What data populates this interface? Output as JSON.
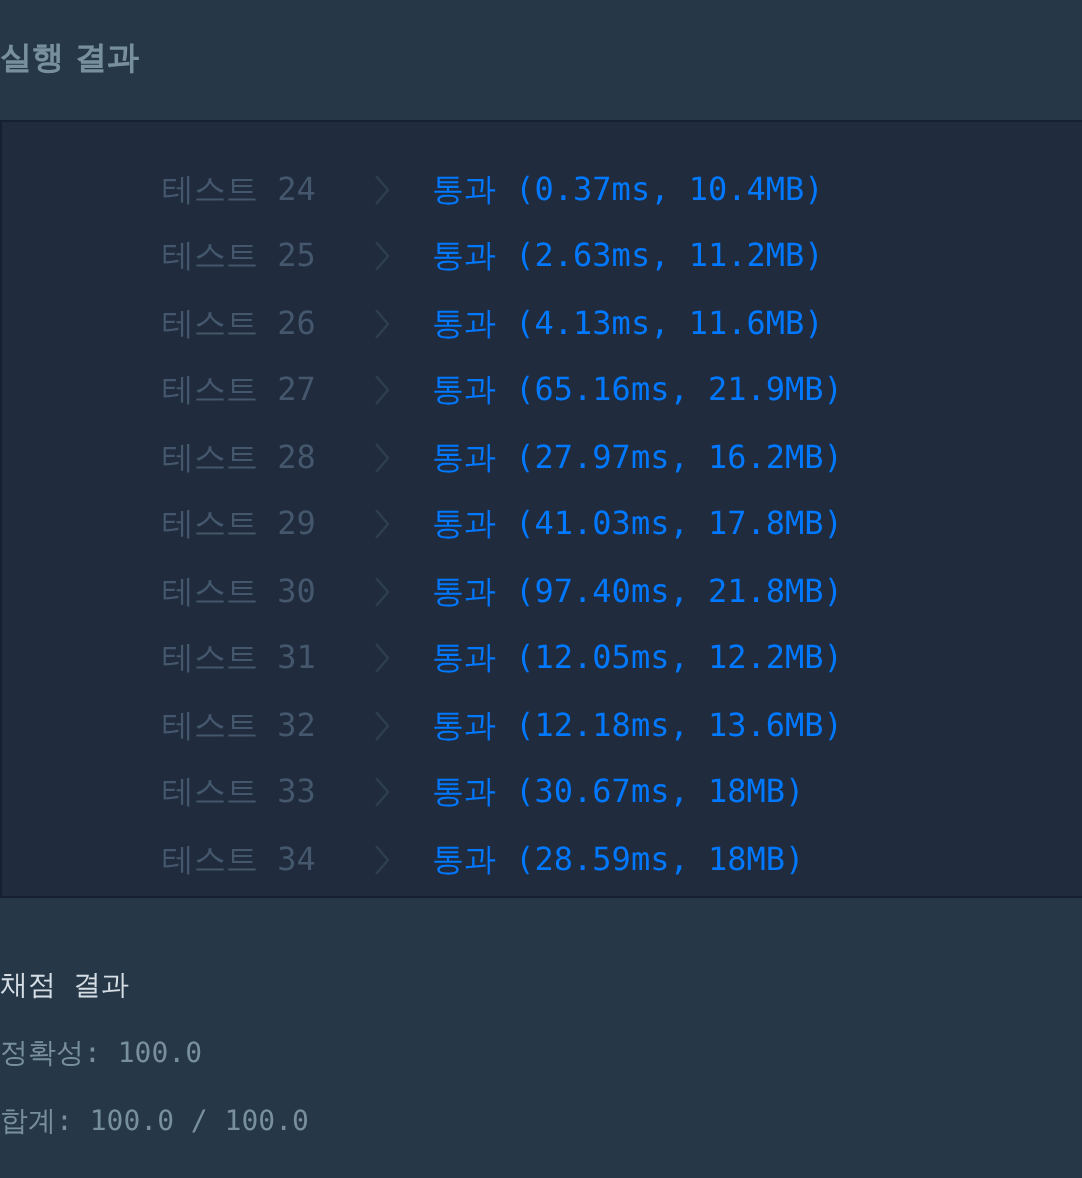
{
  "header": {
    "title": "실행 결과"
  },
  "tests": [
    {
      "label": "테스트 24",
      "result": "통과",
      "detail": "(0.37ms, 10.4MB)",
      "passed": true
    },
    {
      "label": "테스트 25",
      "result": "통과",
      "detail": "(2.63ms, 11.2MB)",
      "passed": true
    },
    {
      "label": "테스트 26",
      "result": "통과",
      "detail": "(4.13ms, 11.6MB)",
      "passed": true
    },
    {
      "label": "테스트 27",
      "result": "통과",
      "detail": "(65.16ms, 21.9MB)",
      "passed": true
    },
    {
      "label": "테스트 28",
      "result": "통과",
      "detail": "(27.97ms, 16.2MB)",
      "passed": true
    },
    {
      "label": "테스트 29",
      "result": "통과",
      "detail": "(41.03ms, 17.8MB)",
      "passed": true
    },
    {
      "label": "테스트 30",
      "result": "통과",
      "detail": "(97.40ms, 21.8MB)",
      "passed": true
    },
    {
      "label": "테스트 31",
      "result": "통과",
      "detail": "(12.05ms, 12.2MB)",
      "passed": true
    },
    {
      "label": "테스트 32",
      "result": "통과",
      "detail": "(12.18ms, 13.6MB)",
      "passed": true
    },
    {
      "label": "테스트 33",
      "result": "통과",
      "detail": "(30.67ms, 18MB)",
      "passed": true
    },
    {
      "label": "테스트 34",
      "result": "통과",
      "detail": "(28.59ms, 18MB)",
      "passed": true
    }
  ],
  "summary": {
    "title": "채점 결과",
    "accuracy": "정확성: 100.0",
    "total": "합계: 100.0 / 100.0"
  }
}
